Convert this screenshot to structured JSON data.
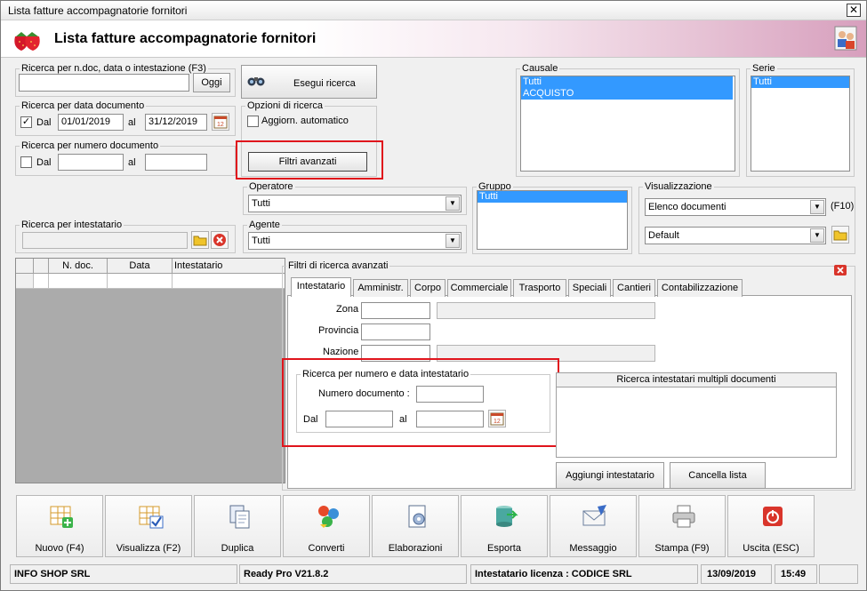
{
  "window": {
    "title": "Lista fatture accompagnatorie fornitori",
    "close_glyph": "✕"
  },
  "banner": {
    "title": "Lista fatture accompagnatorie fornitori"
  },
  "search_text": {
    "legend": "Ricerca per n.doc, data o intestazione (F3)",
    "value": "",
    "oggi_label": "Oggi"
  },
  "esegui": {
    "label": "Esegui ricerca"
  },
  "date_search": {
    "legend": "Ricerca per data documento",
    "checked": true,
    "dal_label": "Dal",
    "from": "01/01/2019",
    "al_label": "al",
    "to": "31/12/2019"
  },
  "num_search": {
    "legend": "Ricerca per numero documento",
    "checked": false,
    "dal_label": "Dal",
    "from": "",
    "al_label": "al",
    "to": ""
  },
  "options": {
    "legend": "Opzioni di ricerca",
    "auto_label": "Aggiorn. automatico",
    "auto_checked": false,
    "advanced_label": "Filtri avanzati"
  },
  "causale": {
    "legend": "Causale",
    "items": [
      "Tutti",
      "ACQUISTO"
    ]
  },
  "serie": {
    "legend": "Serie",
    "items": [
      "Tutti"
    ]
  },
  "operatore": {
    "legend": "Operatore",
    "value": "Tutti"
  },
  "agente": {
    "legend": "Agente",
    "value": "Tutti"
  },
  "gruppo": {
    "legend": "Gruppo",
    "items": [
      "Tutti"
    ]
  },
  "visualizzazione": {
    "legend": "Visualizzazione",
    "mode": "Elenco documenti",
    "hotkey": "(F10)",
    "layout": "Default"
  },
  "intestatario": {
    "legend": "Ricerca per intestatario",
    "value": ""
  },
  "grid": {
    "columns": [
      "N. doc.",
      "Data",
      "Intestatario"
    ]
  },
  "advanced": {
    "legend": "Filtri di ricerca avanzati",
    "tabs": [
      "Intestatario",
      "Amministr.",
      "Corpo",
      "Commerciale",
      "Trasporto",
      "Speciali",
      "Cantieri",
      "Contabilizzazione"
    ],
    "zona_label": "Zona",
    "provincia_label": "Provincia",
    "nazione_label": "Nazione",
    "num_data": {
      "legend": "Ricerca per numero e data intestatario",
      "numero_label": "Numero documento :",
      "dal_label": "Dal",
      "al_label": "al"
    },
    "multi": {
      "header": "Ricerca intestatari multipli documenti",
      "add_label": "Aggiungi intestatario",
      "clear_label": "Cancella lista"
    }
  },
  "toolbar": [
    {
      "label": "Nuovo (F4)",
      "icon": "new-document-icon"
    },
    {
      "label": "Visualizza (F2)",
      "icon": "view-document-icon"
    },
    {
      "label": "Duplica",
      "icon": "duplicate-icon"
    },
    {
      "label": "Converti",
      "icon": "convert-icon"
    },
    {
      "label": "Elaborazioni",
      "icon": "process-icon"
    },
    {
      "label": "Esporta",
      "icon": "export-icon"
    },
    {
      "label": "Messaggio",
      "icon": "message-icon"
    },
    {
      "label": "Stampa (F9)",
      "icon": "printer-icon"
    },
    {
      "label": "Uscita (ESC)",
      "icon": "exit-icon"
    }
  ],
  "status": {
    "company": "INFO SHOP SRL",
    "version": "Ready Pro V21.8.2",
    "license": "Intestatario licenza : CODICE SRL",
    "date": "13/09/2019",
    "time": "15:49"
  },
  "colors": {
    "selection": "#3399ff",
    "highlight_border": "#e0141c",
    "banner_pink": "#d79fbd"
  }
}
